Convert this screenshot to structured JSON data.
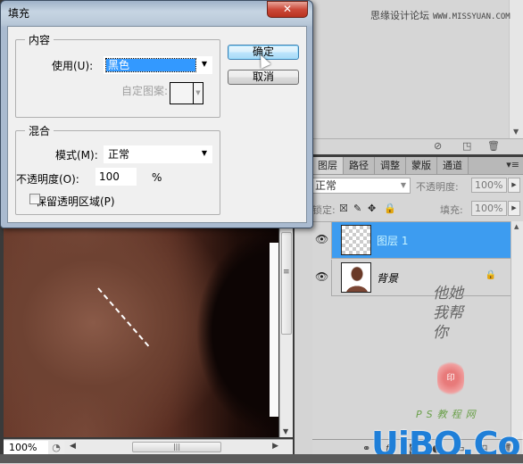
{
  "dialog": {
    "title": "填充",
    "close_label": "✕",
    "contents_group": {
      "legend": "内容",
      "use_label": "使用(U):",
      "use_value": "黑色",
      "custom_pattern_label": "自定图案:"
    },
    "blending_group": {
      "legend": "混合",
      "mode_label": "模式(M):",
      "mode_value": "正常",
      "opacity_label": "不透明度(O):",
      "opacity_value": "100",
      "opacity_unit": "%",
      "preserve_transparency_label": "保留透明区域(P)",
      "preserve_transparency_checked": false
    },
    "ok_label": "确定",
    "cancel_label": "取消"
  },
  "document": {
    "zoom_level": "100%",
    "status_icon": "◔",
    "scroll_left": "◀",
    "scroll_right": "▶",
    "scroll_grip": "|||"
  },
  "top_panel": {
    "watermark_cn": "思缘设计论坛",
    "watermark_url": "WWW.MISSYUAN.COM",
    "footer_icons": [
      "⊘",
      "◳",
      "🗑"
    ]
  },
  "layers_panel": {
    "tabs": [
      {
        "label": "图层",
        "active": true
      },
      {
        "label": "路径",
        "active": false
      },
      {
        "label": "调整",
        "active": false
      },
      {
        "label": "蒙版",
        "active": false
      },
      {
        "label": "通道",
        "active": false
      }
    ],
    "menu_icon": "▾≡",
    "blend_mode": "正常",
    "opacity_label": "不透明度:",
    "opacity_value": "100%",
    "lock_label": "锁定:",
    "lock_icons": [
      "☒",
      "✎",
      "✥",
      "🔒"
    ],
    "fill_label": "填充:",
    "fill_value": "100%",
    "layers": [
      {
        "name": "图层 1",
        "selected": true,
        "thumbnail": "transparent",
        "locked": false
      },
      {
        "name": "背景",
        "selected": false,
        "thumbnail": "photo",
        "locked": true
      }
    ],
    "footer_icons": [
      "⚭",
      "fx",
      "◙",
      "◐",
      "▭",
      "◳",
      "🗑"
    ]
  },
  "overlays": {
    "calligraphy": "他她我帮你",
    "seal_text": "印",
    "ps_site": "PS教程网",
    "logo": "UiBQ.CoM"
  }
}
